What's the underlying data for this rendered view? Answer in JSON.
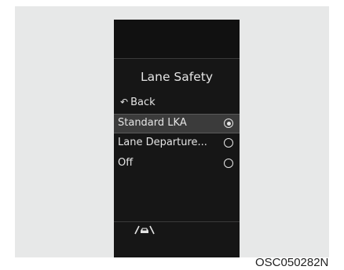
{
  "menu": {
    "title": "Lane Safety",
    "back_label": "Back",
    "options": [
      {
        "label": "Standard LKA",
        "selected": true
      },
      {
        "label": "Lane Departure...",
        "selected": false
      },
      {
        "label": "Off",
        "selected": false
      }
    ]
  },
  "footer": {
    "status_icon": "lane-assist-icon"
  },
  "figure_code": "OSC050282N",
  "colors": {
    "screen_background": "#161616",
    "text": "#e4e4e4",
    "selected_row": "#3b3b3b",
    "frame": "#e7e8e8"
  }
}
